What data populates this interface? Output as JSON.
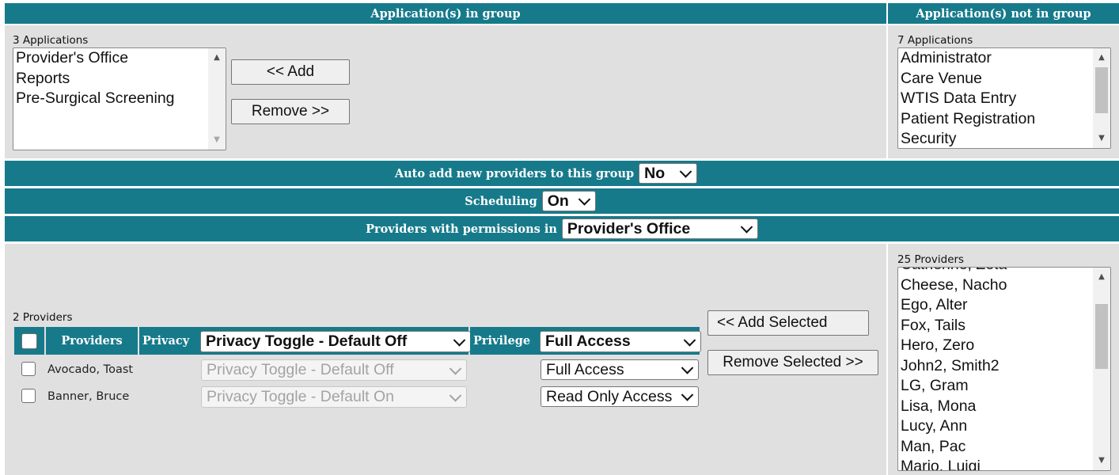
{
  "apps": {
    "in_group_header": "Application(s) in group",
    "not_in_group_header": "Application(s) not in group",
    "in_count": "3 Applications",
    "in_items": [
      "Provider's Office",
      "Reports",
      "Pre-Surgical Screening"
    ],
    "out_count": "7 Applications",
    "out_items": [
      "Administrator",
      "Care Venue",
      "WTIS Data Entry",
      "Patient Registration",
      "Security"
    ],
    "add_label": "<< Add",
    "remove_label": "Remove >>"
  },
  "auto_add": {
    "label": "Auto add new providers to this group",
    "value": "No"
  },
  "scheduling": {
    "label": "Scheduling",
    "value": "On"
  },
  "permissions": {
    "label": "Providers with permissions in",
    "value": "Provider's Office"
  },
  "providers": {
    "count": "2 Providers",
    "col_providers": "Providers",
    "col_privacy": "Privacy",
    "col_privilege": "Privilege",
    "privacy_header_value": "Privacy Toggle - Default Off",
    "privilege_header_value": "Full Access",
    "rows": [
      {
        "name": "Avocado, Toast",
        "privacy": "Privacy Toggle - Default Off",
        "privilege": "Full Access"
      },
      {
        "name": "Banner, Bruce",
        "privacy": "Privacy Toggle - Default On",
        "privilege": "Read Only Access"
      }
    ],
    "add_selected_label": "<< Add Selected",
    "remove_selected_label": "Remove Selected >>",
    "available_count": "25 Providers",
    "available_partial_top": "Catherine, Zeta",
    "available_items": [
      "Cheese, Nacho",
      "Ego, Alter",
      "Fox, Tails",
      "Hero, Zero",
      "John2, Smith2",
      "LG, Gram",
      "Lisa, Mona",
      "Lucy, Ann",
      "Man, Pac",
      "Mario, Luigi"
    ]
  }
}
